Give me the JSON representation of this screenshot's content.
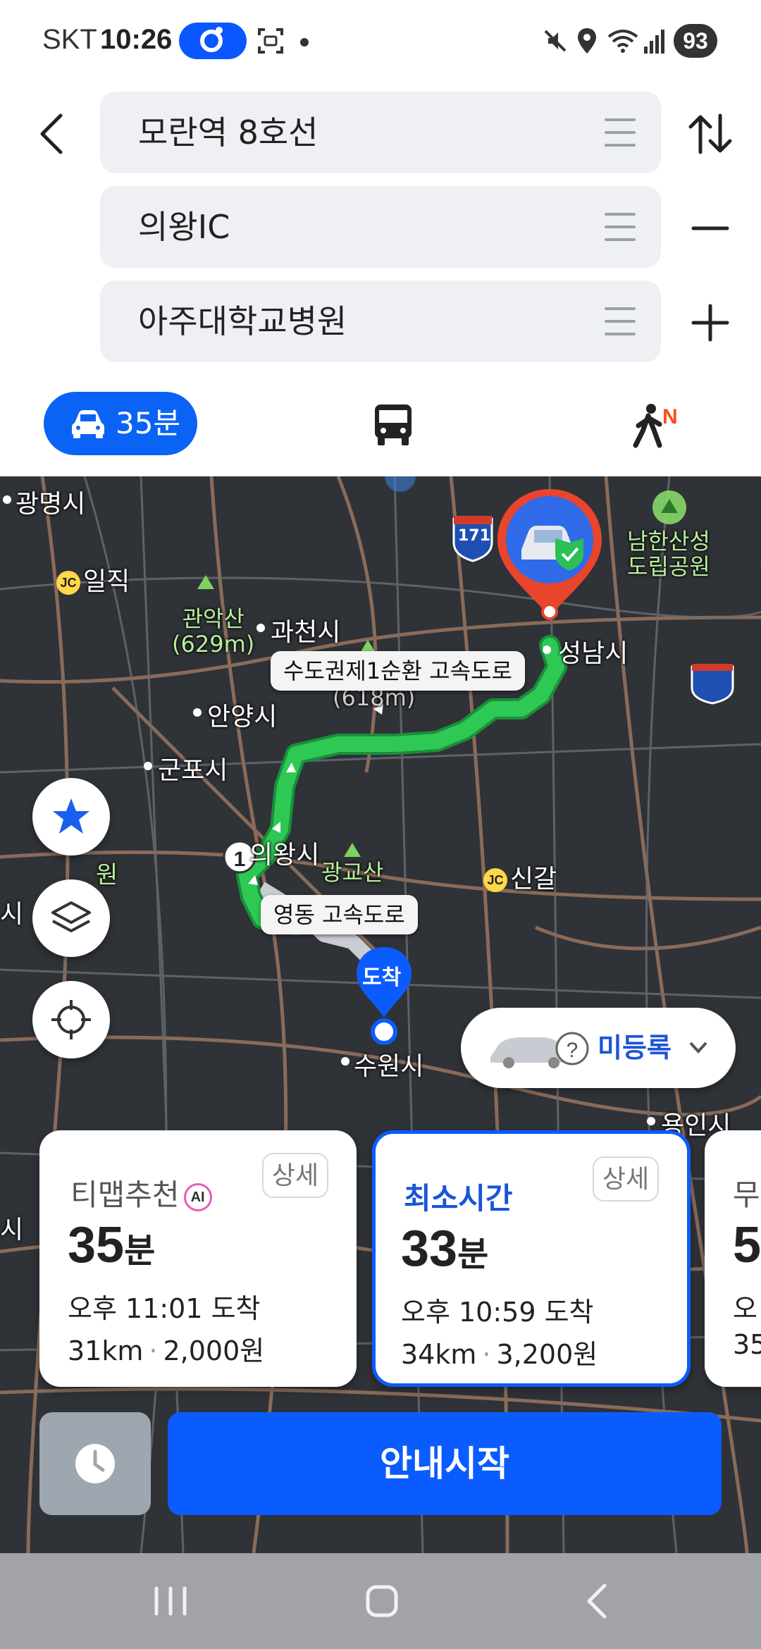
{
  "status_bar": {
    "carrier": "SKT",
    "time": "10:26",
    "battery": "93",
    "icons": [
      "app-pill-icon",
      "screenshot-icon",
      "mute-icon",
      "location-icon",
      "wifi-icon",
      "signal-icon"
    ]
  },
  "route": {
    "origin": "모란역 8호선",
    "waypoint": "의왕IC",
    "destination": "아주대학교병원"
  },
  "modes": {
    "car_label": "35분",
    "walk_badge": "N"
  },
  "map": {
    "places": {
      "gwangmyeong": "광명시",
      "gwacheon": "과천시",
      "anyang": "안양시",
      "gunpo": "군포시",
      "uiwang": "의왕시",
      "seongnam": "성남시",
      "suwon": "수원시",
      "yongin": "용인시",
      "gwanaksan": "관악산\n(629m)",
      "gwanggyosan": "광교산",
      "namhansanseong": "남한산성\n도립공원",
      "cheonggyesan_height": "(618m)",
      "left_si_1": "시",
      "left_si_2": "시",
      "left_won": "원"
    },
    "junctions": {
      "iljik": "일직",
      "singal": "신갈",
      "jc": "JC"
    },
    "route_shield": "171",
    "road_labels": {
      "sudogwon": "수도권제1순환 고속도로",
      "yeongdong": "영동 고속도로"
    },
    "waypoint_marker": "1",
    "arrival_marker": "도착",
    "car_register": "미등록"
  },
  "cards": [
    {
      "title": "티맵추천",
      "ai_badge": "AI",
      "detail": "상세",
      "duration": "35",
      "duration_unit": "분",
      "arrival": "오후 11:01 도착",
      "distance": "31km",
      "toll": "2,000원"
    },
    {
      "title": "최소시간",
      "detail": "상세",
      "duration": "33",
      "duration_unit": "분",
      "arrival": "오후 10:59 도착",
      "distance": "34km",
      "toll": "3,200원"
    },
    {
      "title": "무",
      "duration": "5",
      "arrival": "오",
      "distance": "35"
    }
  ],
  "actions": {
    "start_label": "안내시작"
  },
  "colors": {
    "accent": "#0b5cff",
    "route": "#22b14c",
    "map_bg": "#2f3237",
    "destination_pin": "#e8452c"
  }
}
